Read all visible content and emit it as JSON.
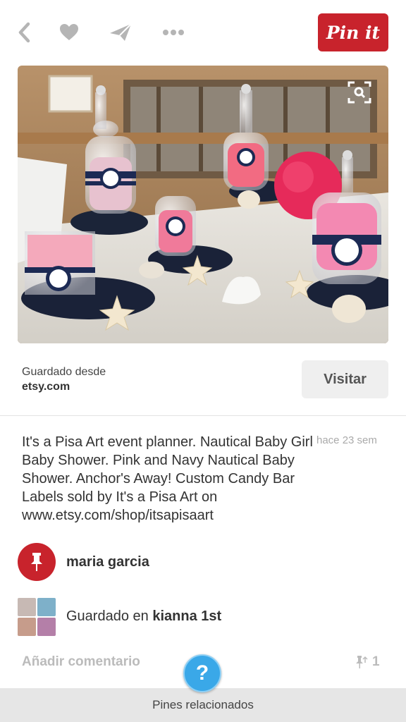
{
  "toolbar": {
    "back_icon": "chevron-left-icon",
    "like_icon": "heart-icon",
    "send_icon": "paper-plane-icon",
    "more_icon": "more-dots-icon",
    "pinit_label": "Pin it",
    "pinit_color": "#c8232c"
  },
  "pin": {
    "image_alt": "",
    "visual_search_icon": "visual-search-icon",
    "saved_from_label": "Guardado desde",
    "source": "etsy.com",
    "visit_label": "Visitar",
    "description": "It's a Pisa Art event planner. Nautical Baby Girl Baby Shower. Pink and Navy Nautical Baby Shower. Anchor's Away! Custom Candy Bar Labels sold by It's a Pisa Art on www.etsy.com/shop/itsapisaart",
    "time_ago": "hace 23 sem"
  },
  "pinner": {
    "name": "maria garcia",
    "avatar_icon": "pushpin-icon"
  },
  "board": {
    "saved_in_label": "Guardado en",
    "name": "kianna 1st"
  },
  "actions": {
    "comment_placeholder": "Añadir comentario",
    "repin_count": "1",
    "help_label": "?"
  },
  "footer": {
    "related_label": "Pines relacionados"
  }
}
